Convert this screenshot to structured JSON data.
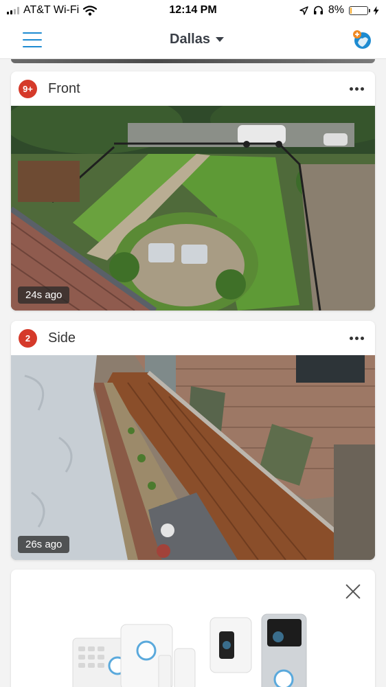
{
  "status_bar": {
    "carrier": "AT&T Wi-Fi",
    "time": "12:14 PM",
    "battery_percent": "8%",
    "battery_level": 0.08,
    "icons": [
      "wifi-icon",
      "location-arrow-icon",
      "headphones-icon",
      "battery-icon",
      "charging-bolt-icon"
    ]
  },
  "header": {
    "location": "Dallas",
    "icons": [
      "hamburger-menu-icon",
      "chevron-down-icon",
      "add-device-icon"
    ]
  },
  "cameras": [
    {
      "badge": "9+",
      "name": "Front",
      "last_snapshot": "24s ago"
    },
    {
      "badge": "2",
      "name": "Side",
      "last_snapshot": "26s ago"
    }
  ],
  "promo": {
    "icons": [
      "close-icon"
    ]
  },
  "colors": {
    "accent": "#1d8bd1",
    "badge": "#d53a2a",
    "battery_low": "#f5a623"
  }
}
